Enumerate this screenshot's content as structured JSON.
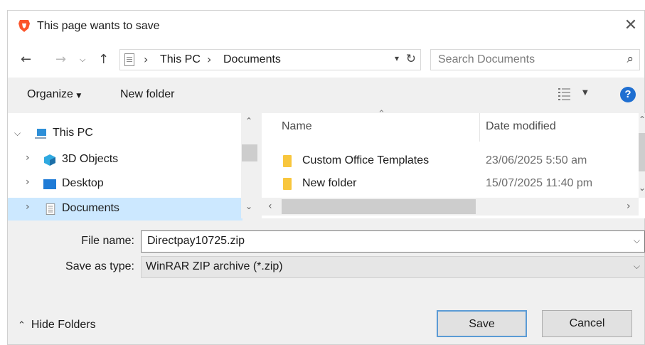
{
  "dialog": {
    "title": "This page wants to save",
    "close_icon": "close-icon"
  },
  "nav": {
    "back_icon": "arrow-left-icon",
    "forward_icon": "arrow-right-icon",
    "recent_icon": "chevron-down-icon",
    "up_icon": "arrow-up-icon",
    "address": {
      "crumbs": [
        "This PC",
        "Documents"
      ]
    },
    "refresh_icon": "refresh-icon",
    "search_placeholder": "Search Documents"
  },
  "toolbar": {
    "organize_label": "Organize",
    "new_folder_label": "New folder"
  },
  "tree": {
    "items": [
      {
        "label": "This PC",
        "icon": "computer-icon",
        "expanded": true
      },
      {
        "label": "3D Objects",
        "icon": "cube-icon"
      },
      {
        "label": "Desktop",
        "icon": "desktop-icon"
      },
      {
        "label": "Documents",
        "icon": "document-icon",
        "selected": true
      }
    ]
  },
  "files": {
    "headers": {
      "name": "Name",
      "date": "Date modified"
    },
    "rows": [
      {
        "name": "Custom Office Templates",
        "date": "23/06/2025 5:50 am",
        "icon": "folder-icon"
      },
      {
        "name": "New folder",
        "date": "15/07/2025 11:40 pm",
        "icon": "folder-icon"
      }
    ]
  },
  "form": {
    "filename_label": "File name:",
    "filename_value": "Directpay10725.zip",
    "type_label": "Save as type:",
    "type_value": "WinRAR ZIP archive (*.zip)"
  },
  "footer": {
    "hide_folders_label": "Hide Folders",
    "save_label": "Save",
    "cancel_label": "Cancel"
  },
  "colors": {
    "accent": "#1f6fd1",
    "selection": "#cce8ff",
    "folder": "#f8c63d",
    "brave": "#fb542b"
  }
}
